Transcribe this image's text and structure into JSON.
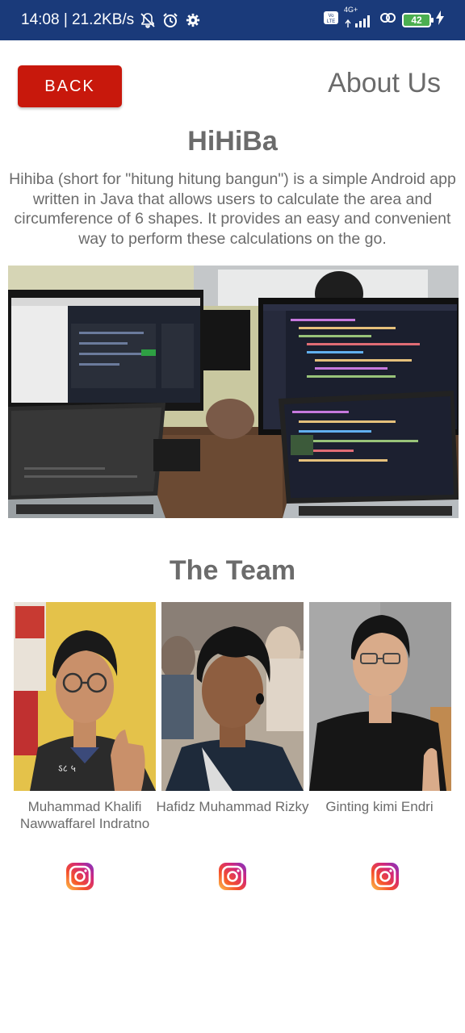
{
  "status_bar": {
    "time_speed": "14:08 | 21.2KB/s",
    "network": "4G+",
    "battery": "42",
    "icons": [
      "bell-off-icon",
      "alarm-icon",
      "gear-icon",
      "volte-icon",
      "signal-icon",
      "hotspot-icon",
      "battery-icon",
      "charging-icon"
    ]
  },
  "header": {
    "back_label": "BACK",
    "title": "About Us"
  },
  "app": {
    "name": "HiHiBa",
    "description": "Hihiba (short for \"hitung hitung bangun\") is a simple Android app written in Java that allows users to calculate the area and circumference of 6 shapes. It provides an easy and convenient way to perform these calculations on the go."
  },
  "team": {
    "heading": "The Team",
    "members": [
      {
        "name": "Muhammad Khalifi Nawwaffarel Indratno"
      },
      {
        "name": "Hafidz Muhammad Rizky"
      },
      {
        "name": "Ginting kimi Endri"
      }
    ]
  },
  "colors": {
    "status_bar": "#1a3a7a",
    "back_button": "#c8180c",
    "text_gray": "#6b6b6b"
  }
}
